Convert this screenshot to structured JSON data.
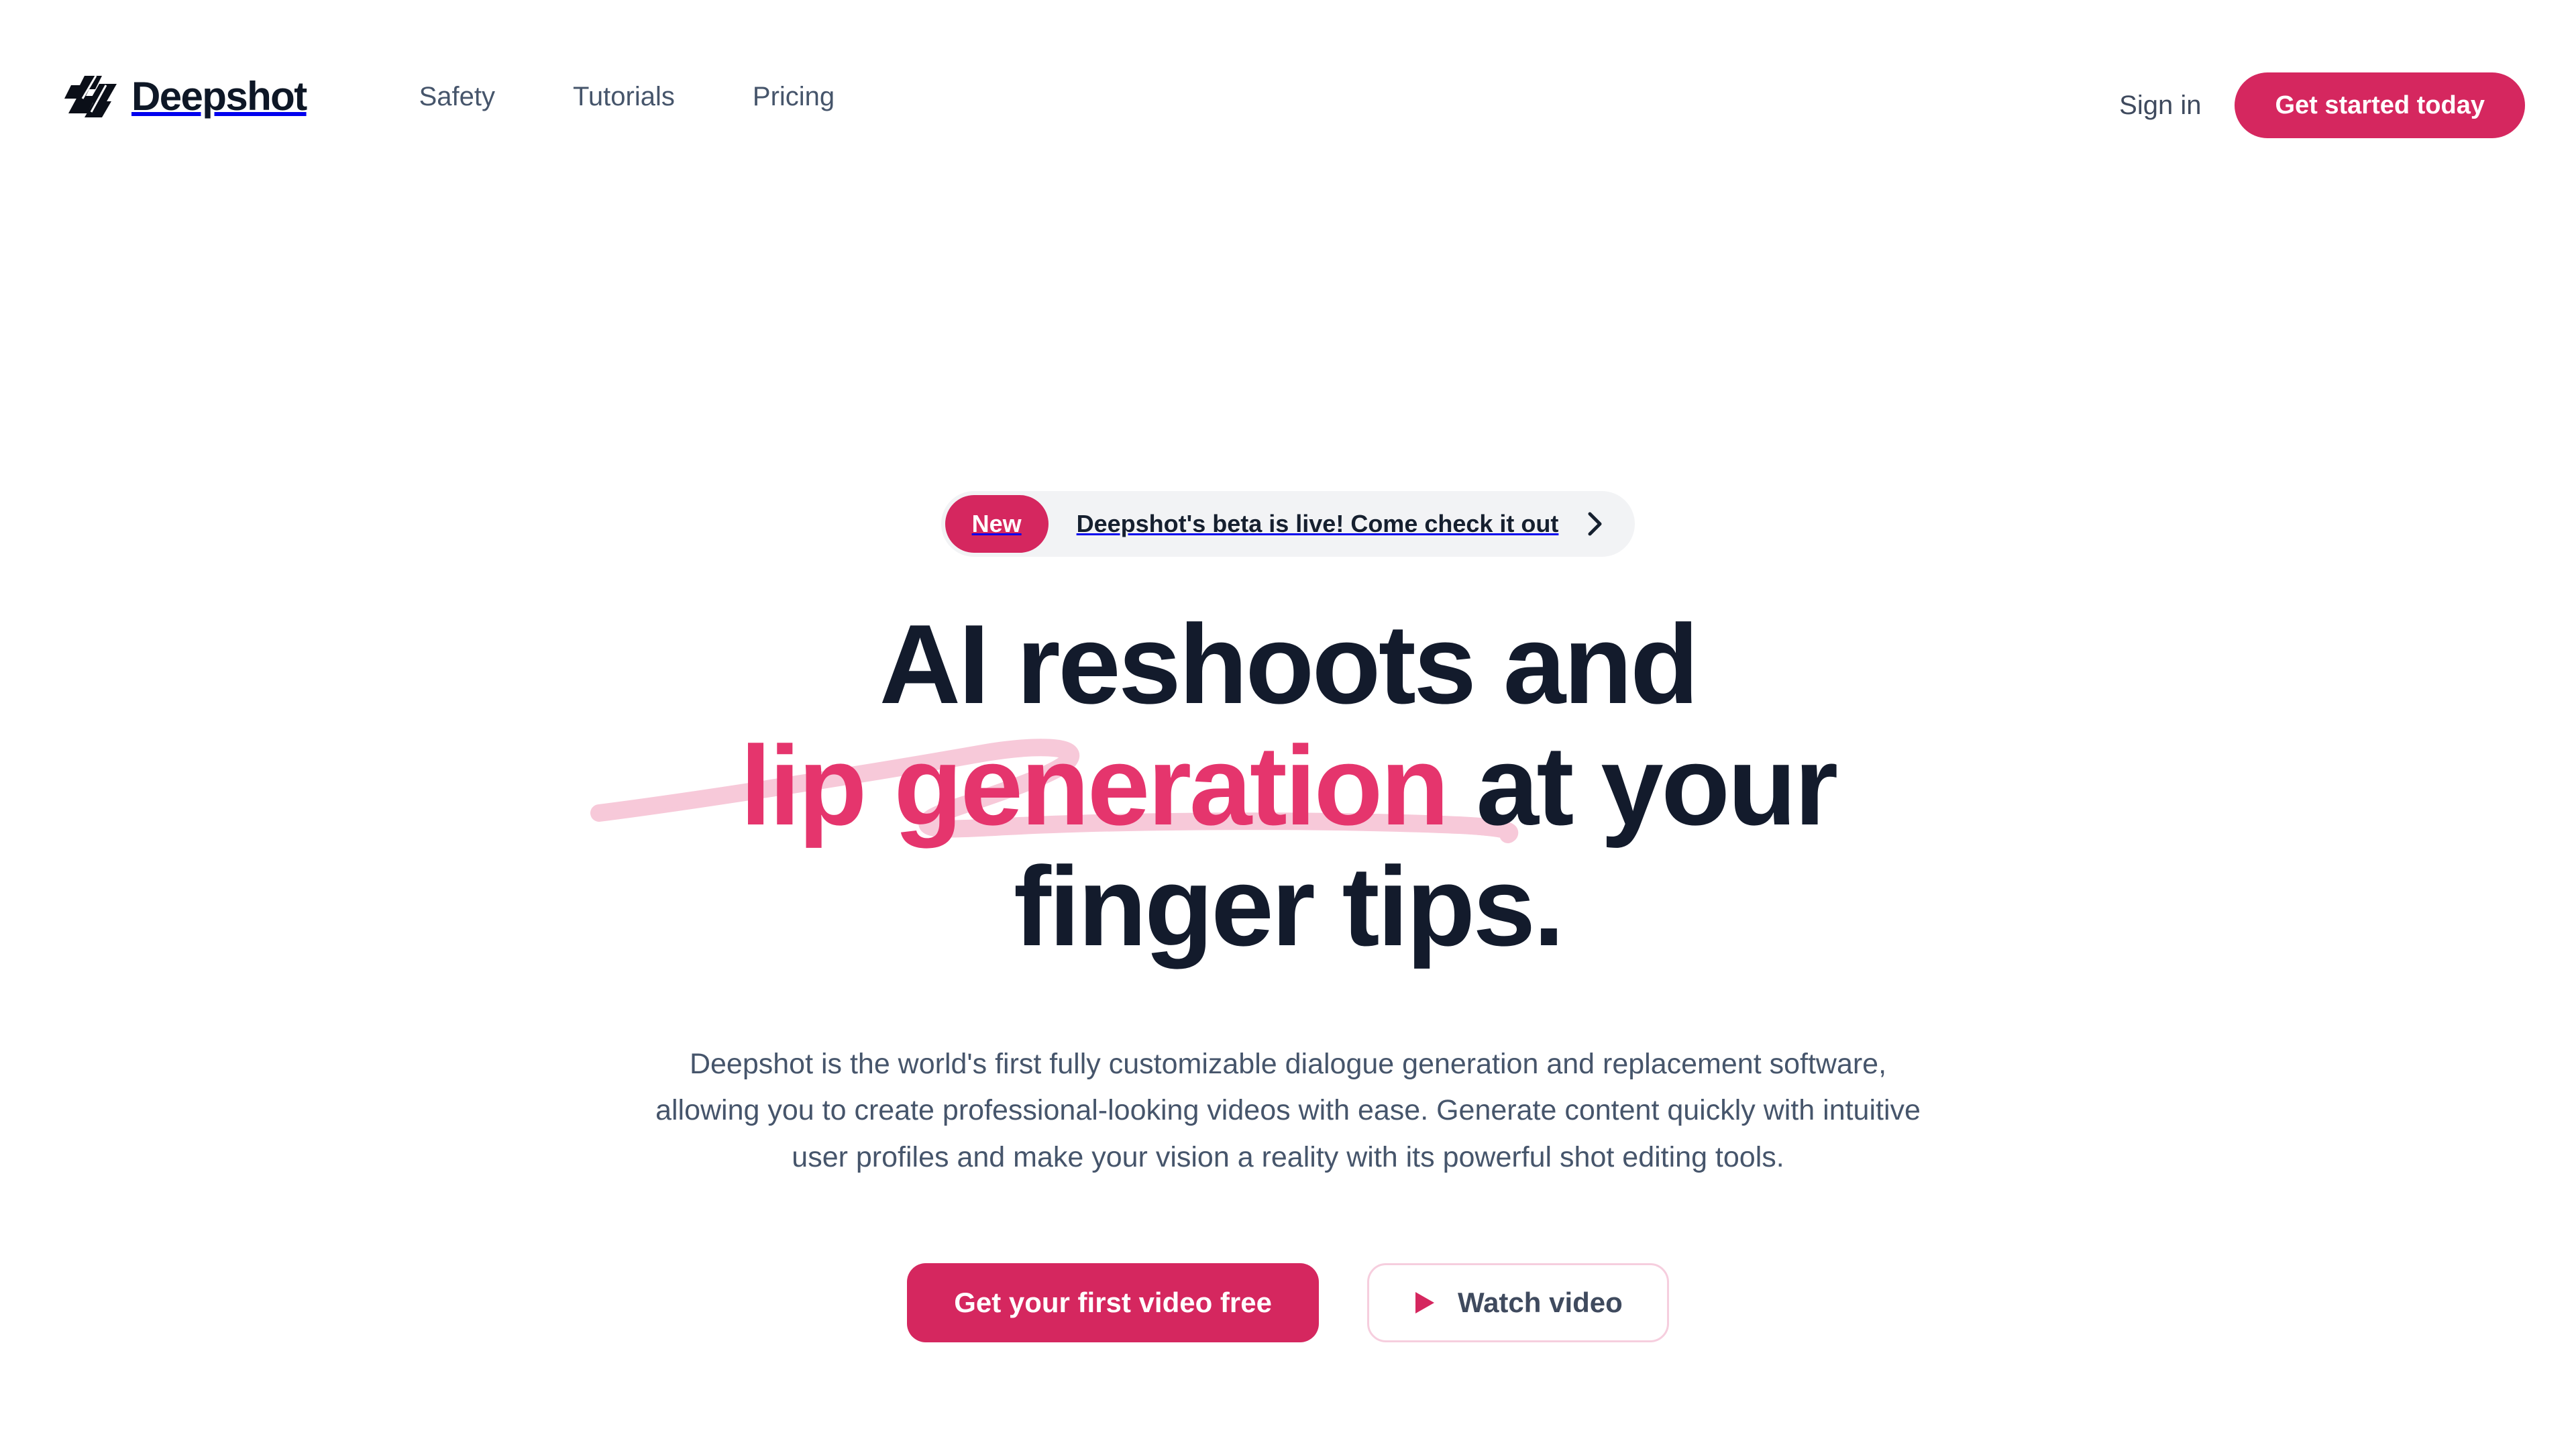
{
  "brand": {
    "name": "Deepshot",
    "logo_icon": "deepshot-wave-logo-icon"
  },
  "nav": {
    "links": [
      {
        "label": "Safety"
      },
      {
        "label": "Tutorials"
      },
      {
        "label": "Pricing"
      }
    ],
    "sign_in_label": "Sign in",
    "cta_label": "Get started today"
  },
  "announcement": {
    "badge_label": "New",
    "text": "Deepshot's beta is live! Come check it out",
    "chevron_icon": "chevron-right-icon"
  },
  "hero": {
    "headline_line1": "AI reshoots and",
    "headline_accent": "lip generation",
    "headline_line2_tail": " at your",
    "headline_line3": "finger tips.",
    "subheading": "Deepshot is the world's first fully customizable dialogue generation and replacement software, allowing you to create professional-looking videos with ease. Generate content quickly with intuitive user profiles and make your vision a reality with its powerful shot editing tools.",
    "primary_cta_label": "Get your first video free",
    "secondary_cta_label": "Watch video",
    "play_icon": "play-triangle-icon"
  },
  "colors": {
    "accent_pink": "#d5275f",
    "heading_pink": "#e5356d",
    "scribble_pink": "#f7c9d9",
    "dark_navy": "#131b2c",
    "body_slate": "#46556b",
    "pill_bg": "#f2f3f5",
    "page_bg": "#ffffff"
  }
}
